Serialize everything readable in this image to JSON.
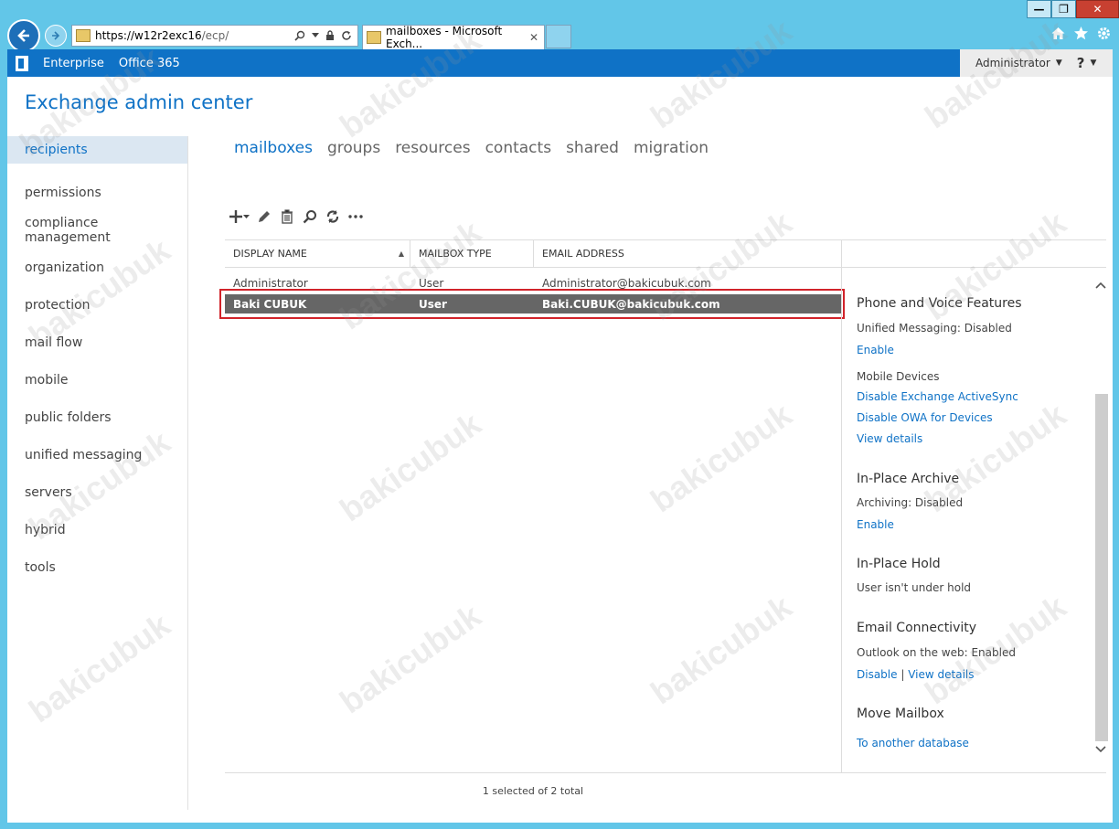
{
  "browser": {
    "url_host": "https://w12r2exc16",
    "url_path": "/ecp/",
    "tab_title": "mailboxes - Microsoft Exch...",
    "tab_close": "✕",
    "window_buttons": {
      "minimize": "—",
      "maximize": "❐",
      "close": "✕"
    }
  },
  "o365bar": {
    "items": [
      "Enterprise",
      "Office 365"
    ],
    "user": "Administrator",
    "caret": "▼",
    "help": "?"
  },
  "app": {
    "title": "Exchange admin center"
  },
  "leftnav": {
    "items": [
      "recipients",
      "permissions",
      "compliance management",
      "organization",
      "protection",
      "mail flow",
      "mobile",
      "public folders",
      "unified messaging",
      "servers",
      "hybrid",
      "tools"
    ]
  },
  "subtabs": [
    "mailboxes",
    "groups",
    "resources",
    "contacts",
    "shared",
    "migration"
  ],
  "toolbar": {
    "add": "+",
    "add_caret": "▾",
    "edit": "✎",
    "delete": "🗑",
    "search": "⚲",
    "refresh": "⟳",
    "more": "•••"
  },
  "grid": {
    "columns": [
      "DISPLAY NAME",
      "MAILBOX TYPE",
      "EMAIL ADDRESS"
    ],
    "sort_indicator": "▲",
    "rows": [
      {
        "name": "Administrator",
        "type": "User",
        "email": "Administrator@bakicubuk.com"
      },
      {
        "name": "Baki CUBUK",
        "type": "User",
        "email": "Baki.CUBUK@bakicubuk.com",
        "selected": true
      }
    ],
    "footer": "1 selected of 2 total"
  },
  "details": {
    "phone_voice": {
      "title": "Phone and Voice Features",
      "unified_messaging": "Unified Messaging:  Disabled",
      "enable": "Enable",
      "mobile_devices": "Mobile Devices",
      "disable_eas": "Disable Exchange ActiveSync",
      "disable_owa": "Disable OWA for Devices",
      "view_details": "View details"
    },
    "archive": {
      "title": "In-Place Archive",
      "status": "Archiving:  Disabled",
      "enable": "Enable"
    },
    "hold": {
      "title": "In-Place Hold",
      "status": "User isn't under hold"
    },
    "connectivity": {
      "title": "Email Connectivity",
      "status": "Outlook on the web:  Enabled",
      "disable": "Disable",
      "separator": "|",
      "view_details": "View details"
    },
    "move": {
      "title": "Move Mailbox",
      "link": "To another database"
    }
  },
  "watermark": "bakicubuk",
  "colors": {
    "accent": "#0f72c6",
    "selected_row": "#666666",
    "highlight_box": "#d1232a",
    "chrome_bg": "#62c6e8"
  }
}
